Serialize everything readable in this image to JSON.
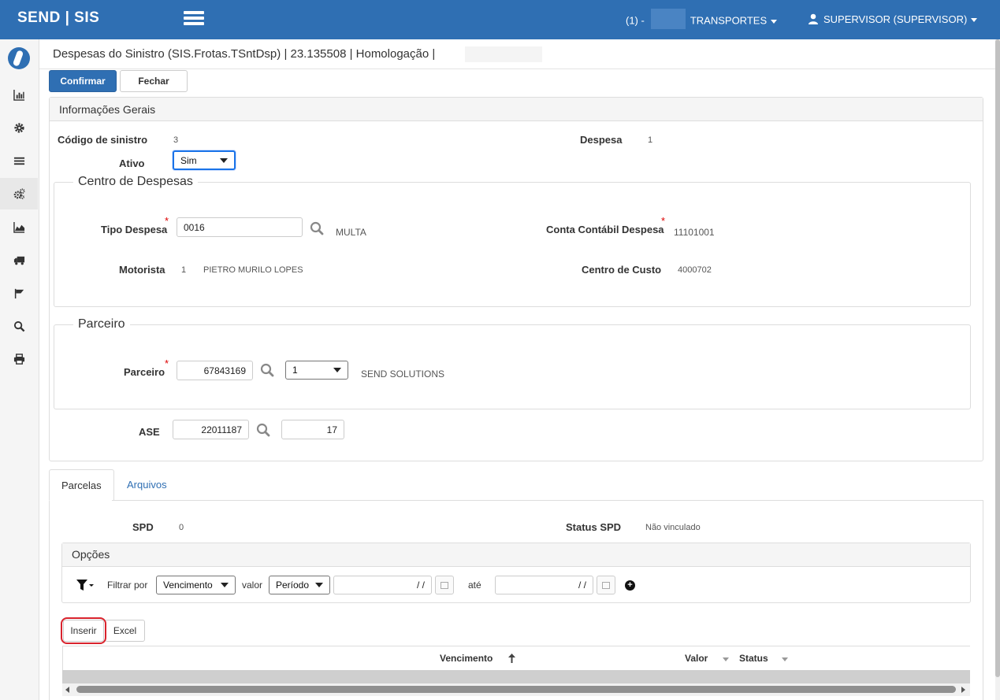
{
  "topbar": {
    "brand": "SEND | SIS",
    "company_prefix": "(1) -",
    "company_name": "TRANSPORTES",
    "user": "SUPERVISOR (SUPERVISOR)"
  },
  "sidebar": {
    "items": [
      "logo-icon",
      "bar-chart-icon",
      "gear-icon",
      "list-icon",
      "gears-icon",
      "area-chart-icon",
      "truck-icon",
      "flag-icon",
      "search-icon",
      "print-icon"
    ]
  },
  "header": {
    "title": "Despesas do Sinistro (SIS.Frotas.TSntDsp) | 23.135508 | Homologação |",
    "confirm_label": "Confirmar",
    "close_label": "Fechar"
  },
  "general": {
    "panel_title": "Informações Gerais",
    "codigo_label": "Código de sinistro",
    "codigo_value": "3",
    "despesa_label": "Despesa",
    "despesa_value": "1",
    "ativo_label": "Ativo",
    "ativo_value": "Sim"
  },
  "centro": {
    "legend": "Centro de Despesas",
    "tipo_label": "Tipo Despesa",
    "tipo_value": "0016",
    "tipo_desc": "MULTA",
    "conta_label": "Conta Contábil Despesa",
    "conta_value": "11101001",
    "motorista_label": "Motorista",
    "motorista_code": "1",
    "motorista_name": "PIETRO MURILO LOPES",
    "centro_custo_label": "Centro de Custo",
    "centro_custo_value": "4000702",
    "required_mark": "*"
  },
  "parceiro": {
    "legend": "Parceiro",
    "label": "Parceiro",
    "code": "67843169",
    "seq": "1",
    "name": "SEND SOLUTIONS",
    "ase_label": "ASE",
    "ase_value": "22011187",
    "ase_seq": "17"
  },
  "tabs": [
    {
      "label": "Parcelas",
      "active": true
    },
    {
      "label": "Arquivos",
      "active": false
    }
  ],
  "parcelas": {
    "spd_label": "SPD",
    "spd_value": "0",
    "status_label": "Status SPD",
    "status_value": "Não vinculado",
    "options_title": "Opções",
    "filter_label": "Filtrar por",
    "filter_field": "Vencimento",
    "valor_label": "valor",
    "period_value": "Período",
    "date_from": "/  /",
    "ate_label": "até",
    "date_to": "/  /",
    "insert_label": "Inserir",
    "excel_label": "Excel",
    "columns": [
      "Vencimento",
      "Valor",
      "Status"
    ]
  }
}
